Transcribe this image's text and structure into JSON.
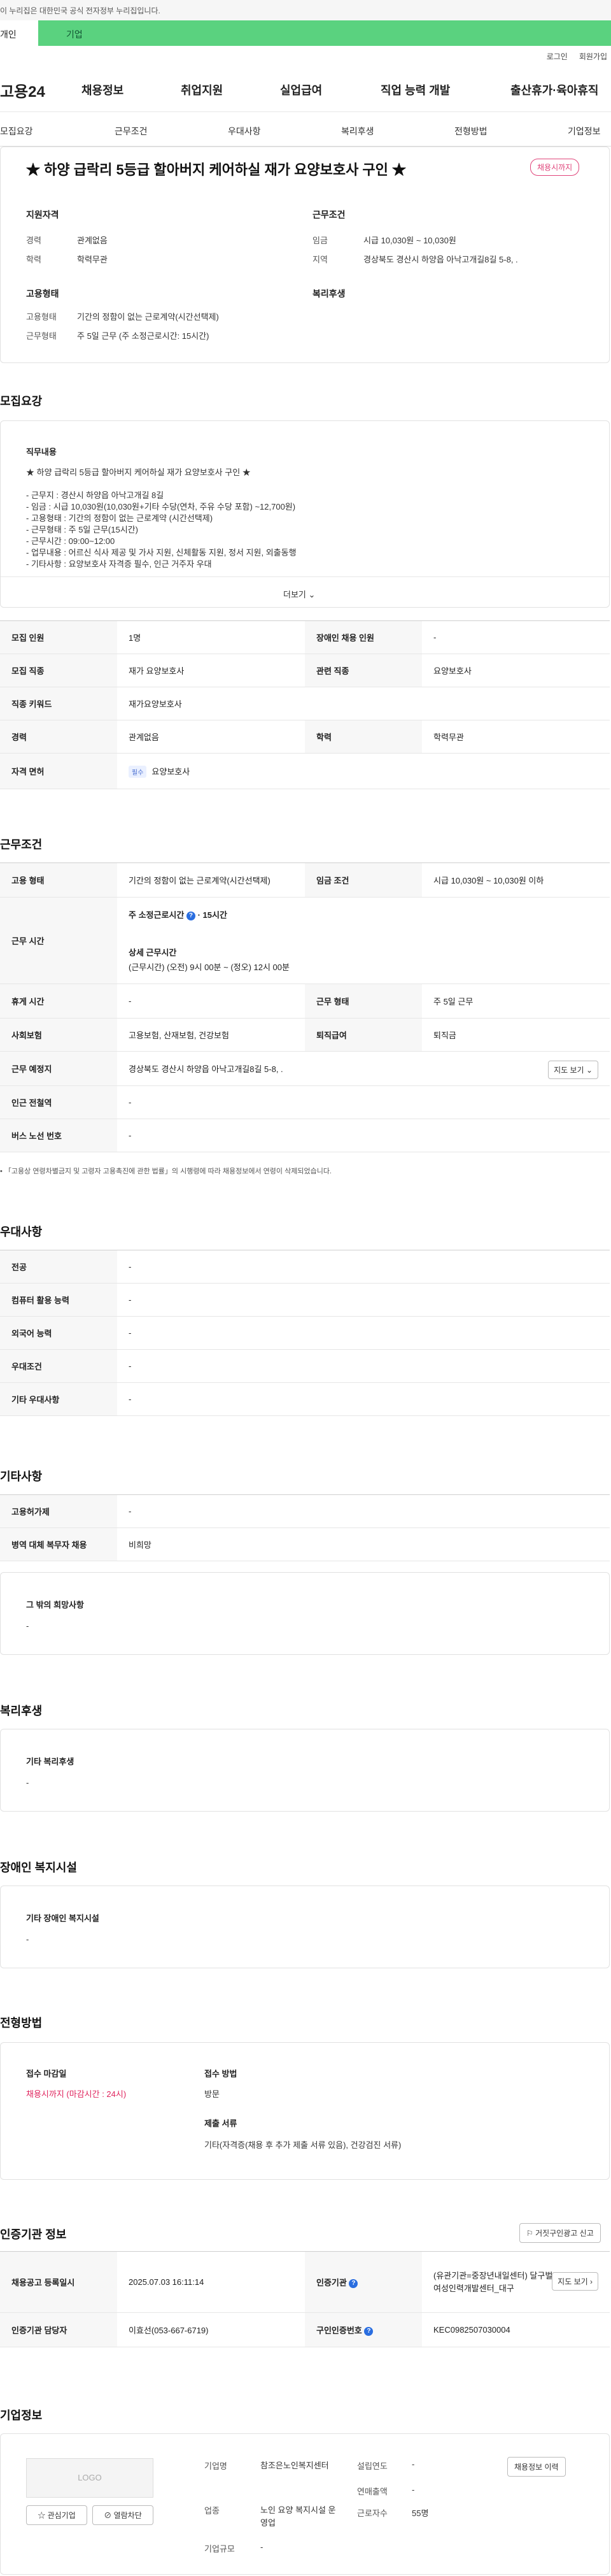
{
  "gov_banner": "이 누리집은 대한민국 공식 전자정부 누리집입니다.",
  "tabs": {
    "personal": "개인",
    "corporate": "기업"
  },
  "utility": {
    "login": "로그인",
    "signup": "회원가입"
  },
  "logo": "고용24",
  "gnb": [
    "채용정보",
    "취업지원",
    "실업급여",
    "직업 능력 개발",
    "출산휴가·육아휴직"
  ],
  "subtabs": [
    "모집요강",
    "근무조건",
    "우대사항",
    "복리후생",
    "전형방법",
    "기업정보"
  ],
  "header": {
    "title": "★ 하양 급락리 5등급 할아버지 케어하실 재가 요양보호사 구인 ★",
    "status": "채용시까지"
  },
  "summary": {
    "qual_title": "지원자격",
    "career_label": "경력",
    "career": "관계없음",
    "edu_label": "학력",
    "edu": "학력무관",
    "work_title": "근무조건",
    "wage_label": "임금",
    "wage": "시급 10,030원 ~ 10,030원",
    "region_label": "지역",
    "region": "경상북도 경산시 하양읍 아낙고개길8길 5-8, .",
    "type_title": "고용형태",
    "emp_label": "고용형태",
    "emp": "기간의 정함이 없는 근로계약(시간선택제)",
    "hours_label": "근무형태",
    "hours": "주 5일 근무 (주 소정근로시간: 15시간)",
    "welfare_title": "복리후생"
  },
  "recruit": {
    "section_title": "모집요강",
    "job_title": "직무내용",
    "job_headline": "★ 하양 급락리 5등급 할아버지 케어하실 재가 요양보호사 구인 ★",
    "job_lines": [
      "- 근무지 : 경산시 하양읍 아낙고개길 8길",
      "- 임금 : 시급 10,030원(10,030원+기타 수당(연차, 주유 수당 포함) ~12,700원)",
      "- 고용형태 : 기간의 정함이 없는 근로계약 (시간선택제)",
      "- 근무형태 : 주 5일 근무(15시간)",
      "- 근무시간 : 09:00~12:00",
      "- 업무내용 : 어르신 식사 제공 및 가사 지원, 신체활동 지원, 정서 지원, 외출동행",
      "- 기타사항 : 요양보호사 자격증 필수, 인근 거주자 우대"
    ],
    "more": "더보기",
    "rows": {
      "headcount_label": "모집 인원",
      "headcount": "1명",
      "disabled_label": "장애인 채용 인원",
      "disabled": "-",
      "job_label": "모집 직종",
      "job": "재가 요양보호사",
      "related_label": "관련 직종",
      "related": "요양보호사",
      "keyword_label": "직종 키워드",
      "keyword": "재가요양보호사",
      "career_label": "경력",
      "career": "관계없음",
      "edu_label": "학력",
      "edu": "학력무관",
      "license_label": "자격 면허",
      "license_tag": "필수",
      "license": "요양보호사"
    }
  },
  "conditions": {
    "section_title": "근무조건",
    "emp_label": "고용 형태",
    "emp": "기간의 정함이 없는 근로계약(시간선택제)",
    "wage_label": "임금 조건",
    "wage": "시급 10,030원 ~ 10,030원 이하",
    "time_label": "근무 시간",
    "weekly_title": "주 소정근로시간",
    "weekly_value": "15시간",
    "detail_title": "상세 근무시간",
    "detail_value": "(근무시간) (오전) 9시 00분 ~ (정오) 12시 00분",
    "rest_label": "휴게 시간",
    "rest": "-",
    "form_label": "근무 형태",
    "form": "주 5일 근무",
    "insurance_label": "사회보험",
    "insurance": "고용보험, 산재보험, 건강보험",
    "severance_label": "퇴직급여",
    "severance": "퇴직금",
    "place_label": "근무 예정지",
    "place": "경상북도 경산시 하양읍 아낙고개길8길 5-8, .",
    "map_button": "지도 보기",
    "subway_label": "인근 전철역",
    "subway": "-",
    "bus_label": "버스 노선 번호",
    "bus": "-",
    "note": "「고용상 연령차별금지 및 고령자 고용촉진에 관한 법률」의 시행령에 따라 채용정보에서 연령이 삭제되었습니다."
  },
  "preferences": {
    "section_title": "우대사항",
    "rows": [
      {
        "label": "전공",
        "value": "-"
      },
      {
        "label": "컴퓨터 활용 능력",
        "value": "-"
      },
      {
        "label": "외국어 능력",
        "value": "-"
      },
      {
        "label": "우대조건",
        "value": "-"
      },
      {
        "label": "기타 우대사항",
        "value": "-"
      }
    ]
  },
  "etc": {
    "section_title": "기타사항",
    "rows": [
      {
        "label": "고용허가제",
        "value": "-"
      },
      {
        "label": "병역 대체 복무자 채용",
        "value": "비희망"
      }
    ],
    "box_title": "그 밖의 희망사항",
    "box_value": "-"
  },
  "welfare": {
    "section_title": "복리후생",
    "box_title": "기타 복리후생",
    "box_value": "-"
  },
  "disability": {
    "section_title": "장애인 복지시설",
    "box_title": "기타 장애인 복지시설",
    "box_value": "-"
  },
  "screening": {
    "section_title": "전형방법",
    "deadline_title": "접수 마감일",
    "deadline": "채용시까지 (마감시간 : 24시)",
    "method_title": "접수 방법",
    "method": "방문",
    "docs_title": "제출 서류",
    "docs": "기타(자격증(채용 후 추가 제출 서류 있음), 건강검진 서류)"
  },
  "certification": {
    "section_title": "인증기관 정보",
    "report_button": "거짓구인광고 신고",
    "reg_label": "채용공고 등록일시",
    "reg": "2025.07.03 16:11:14",
    "agency_label": "인증기관",
    "agency": "(유관기관=중장년내일센터) 달구벌여성인력개발센터_대구",
    "map_button": "지도 보기",
    "manager_label": "인증기관 담당자",
    "manager": "이효선(053-667-6719)",
    "number_label": "구인인증번호",
    "number": "KEC0982507030004"
  },
  "company": {
    "section_title": "기업정보",
    "logo": "LOGO",
    "interest_button": "관심기업",
    "block_button": "열람차단",
    "name_label": "기업명",
    "name": "참조은노인복지센터",
    "founded_label": "설립연도",
    "founded": "-",
    "industry_label": "업종",
    "industry": "노인 요양 복지시설 운영업",
    "sales_label": "연매출액",
    "sales": "-",
    "employees_label": "근로자수",
    "employees": "55명",
    "size_label": "기업규모",
    "size": "-",
    "history_button": "채용정보 이력"
  }
}
